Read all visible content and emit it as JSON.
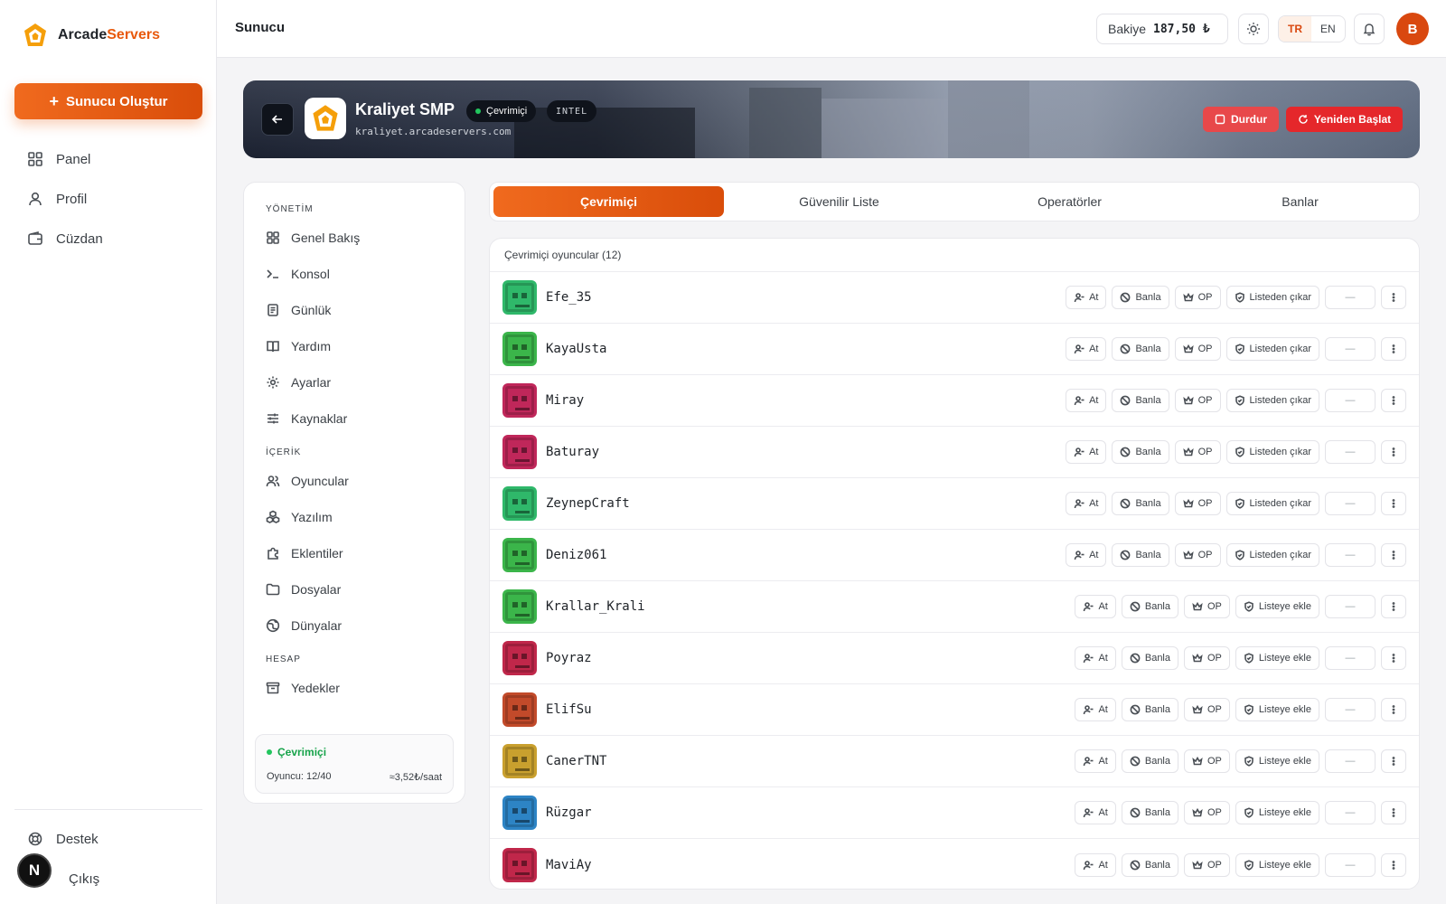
{
  "brand": {
    "name_main": "Arcade",
    "name_accent": "Servers"
  },
  "sidebar": {
    "create_label": "Sunucu Oluştur",
    "items": [
      {
        "label": "Panel",
        "icon": "grid-icon"
      },
      {
        "label": "Profil",
        "icon": "user-icon"
      },
      {
        "label": "Cüzdan",
        "icon": "wallet-icon"
      }
    ],
    "bottom": [
      {
        "label": "Destek",
        "icon": "lifebuoy-icon"
      },
      {
        "label": "Çıkış",
        "icon": "logout-icon"
      }
    ],
    "badge": "N"
  },
  "topbar": {
    "title": "Sunucu",
    "balance_label": "Bakiye",
    "balance_value": "187,50 ₺",
    "lang_tr": "TR",
    "lang_en": "EN",
    "avatar": "B"
  },
  "server": {
    "name": "Kraliyet SMP",
    "status": "Çevrimiçi",
    "cpu": "INTEL",
    "domain": "kraliyet.arcadeservers.com",
    "stop_label": "Durdur",
    "restart_label": "Yeniden Başlat"
  },
  "server_nav": {
    "sections": [
      {
        "title": "YÖNETİM",
        "items": [
          "Genel Bakış",
          "Konsol",
          "Günlük",
          "Yardım",
          "Ayarlar",
          "Kaynaklar"
        ]
      },
      {
        "title": "İÇERİK",
        "items": [
          "Oyuncular",
          "Yazılım",
          "Eklentiler",
          "Dosyalar",
          "Dünyalar"
        ]
      },
      {
        "title": "HESAP",
        "items": [
          "Yedekler"
        ]
      }
    ],
    "status": {
      "label": "Çevrimiçi",
      "players": "Oyuncu: 12/40",
      "rate": "≈3,52₺/saat"
    }
  },
  "tabs": [
    "Çevrimiçi",
    "Güvenilir Liste",
    "Operatörler",
    "Banlar"
  ],
  "players": {
    "header": "Çevrimiçi oyuncular (12)",
    "action_kick": "At",
    "action_ban": "Banla",
    "action_op": "OP",
    "action_remove": "Listeden çıkar",
    "action_add": "Listeye ekle",
    "dash": "—",
    "list": [
      {
        "name": "Efe_35",
        "color": "#2fb86a",
        "whitelisted": true
      },
      {
        "name": "KayaUsta",
        "color": "#3bb54a",
        "whitelisted": true
      },
      {
        "name": "Miray",
        "color": "#c0275a",
        "whitelisted": true
      },
      {
        "name": "Baturay",
        "color": "#c0275a",
        "whitelisted": true
      },
      {
        "name": "ZeynepCraft",
        "color": "#2fb86a",
        "whitelisted": true
      },
      {
        "name": "Deniz061",
        "color": "#3bb54a",
        "whitelisted": true
      },
      {
        "name": "Krallar_Krali",
        "color": "#3bb54a",
        "whitelisted": false
      },
      {
        "name": "Poyraz",
        "color": "#c0274a",
        "whitelisted": false
      },
      {
        "name": "ElifSu",
        "color": "#c24a2a",
        "whitelisted": false
      },
      {
        "name": "CanerTNT",
        "color": "#c9a02e",
        "whitelisted": false
      },
      {
        "name": "Rüzgar",
        "color": "#2d84c5",
        "whitelisted": false
      },
      {
        "name": "MaviAy",
        "color": "#c0274a",
        "whitelisted": false
      }
    ]
  }
}
